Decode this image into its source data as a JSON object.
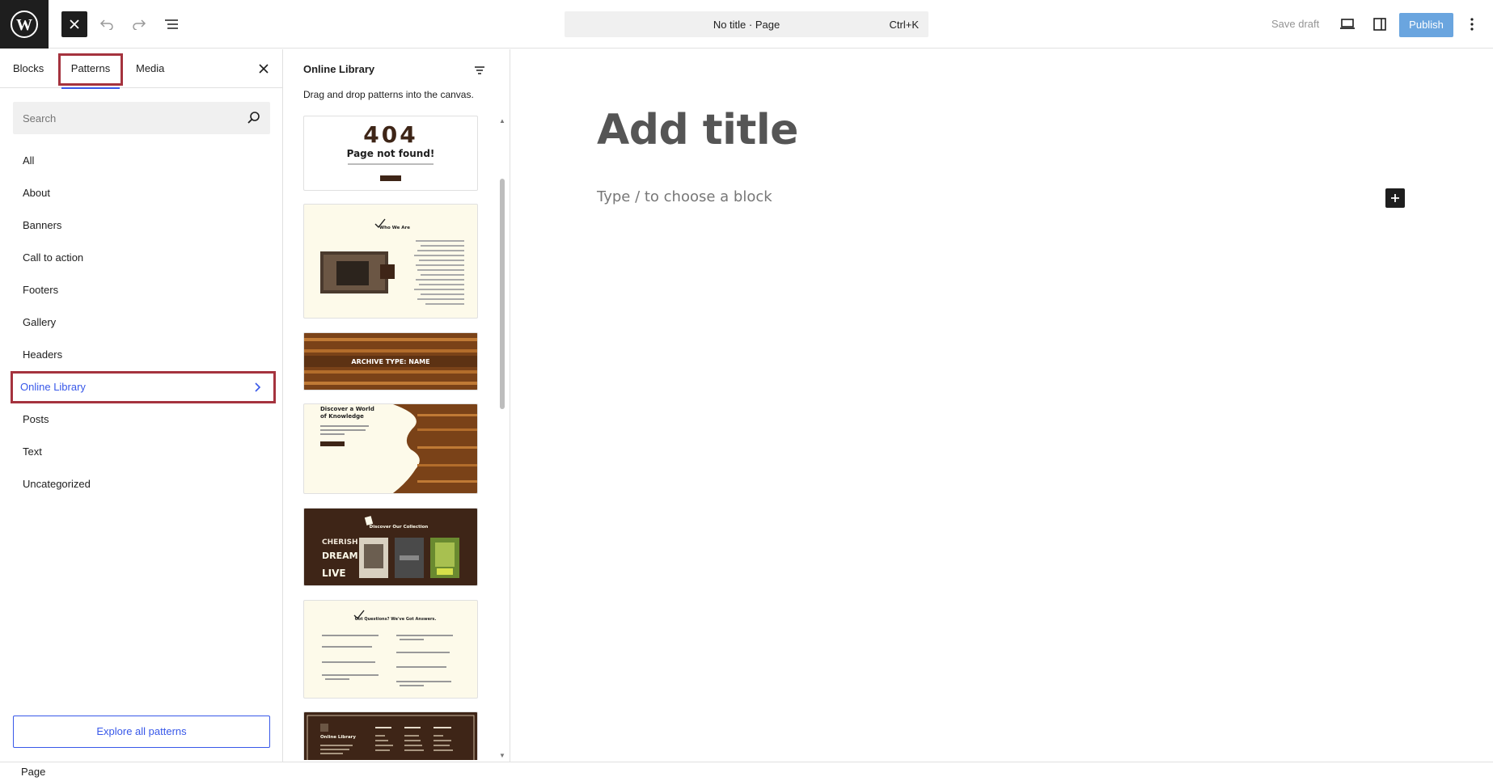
{
  "topbar": {
    "logo_icon": "wordpress-logo",
    "command_title": "No title · Page",
    "command_shortcut": "Ctrl+K",
    "save_draft": "Save draft",
    "publish": "Publish"
  },
  "inserter": {
    "tabs": [
      "Blocks",
      "Patterns",
      "Media"
    ],
    "active_tab": "Patterns",
    "search_placeholder": "Search",
    "categories": [
      "All",
      "About",
      "Banners",
      "Call to action",
      "Footers",
      "Gallery",
      "Headers",
      "Online Library",
      "Posts",
      "Text",
      "Uncategorized"
    ],
    "active_category": "Online Library",
    "explore_button": "Explore all patterns"
  },
  "patterns_panel": {
    "title": "Online Library",
    "description": "Drag and drop patterns into the canvas.",
    "previews": [
      {
        "kind": "404",
        "heading": "404",
        "subheading": "Page not found!"
      },
      {
        "kind": "about",
        "heading": "Who We Are"
      },
      {
        "kind": "banner",
        "heading": "ARCHIVE TYPE: NAME"
      },
      {
        "kind": "hero",
        "heading": "Discover a World of Knowledge"
      },
      {
        "kind": "collection",
        "heading": "Discover Our Collection"
      },
      {
        "kind": "faq",
        "heading": "Got Questions? We've Got Answers."
      },
      {
        "kind": "footer",
        "heading": "Online Library"
      }
    ]
  },
  "canvas": {
    "title_placeholder": "Add title",
    "block_placeholder": "Type / to choose a block"
  },
  "footer": {
    "breadcrumb": "Page"
  },
  "colors": {
    "accent": "#3858e9",
    "highlight": "#a5333e",
    "publish_bg": "#6aa5df",
    "library_brown": "#3e2517",
    "library_cream": "#fdfaea"
  }
}
